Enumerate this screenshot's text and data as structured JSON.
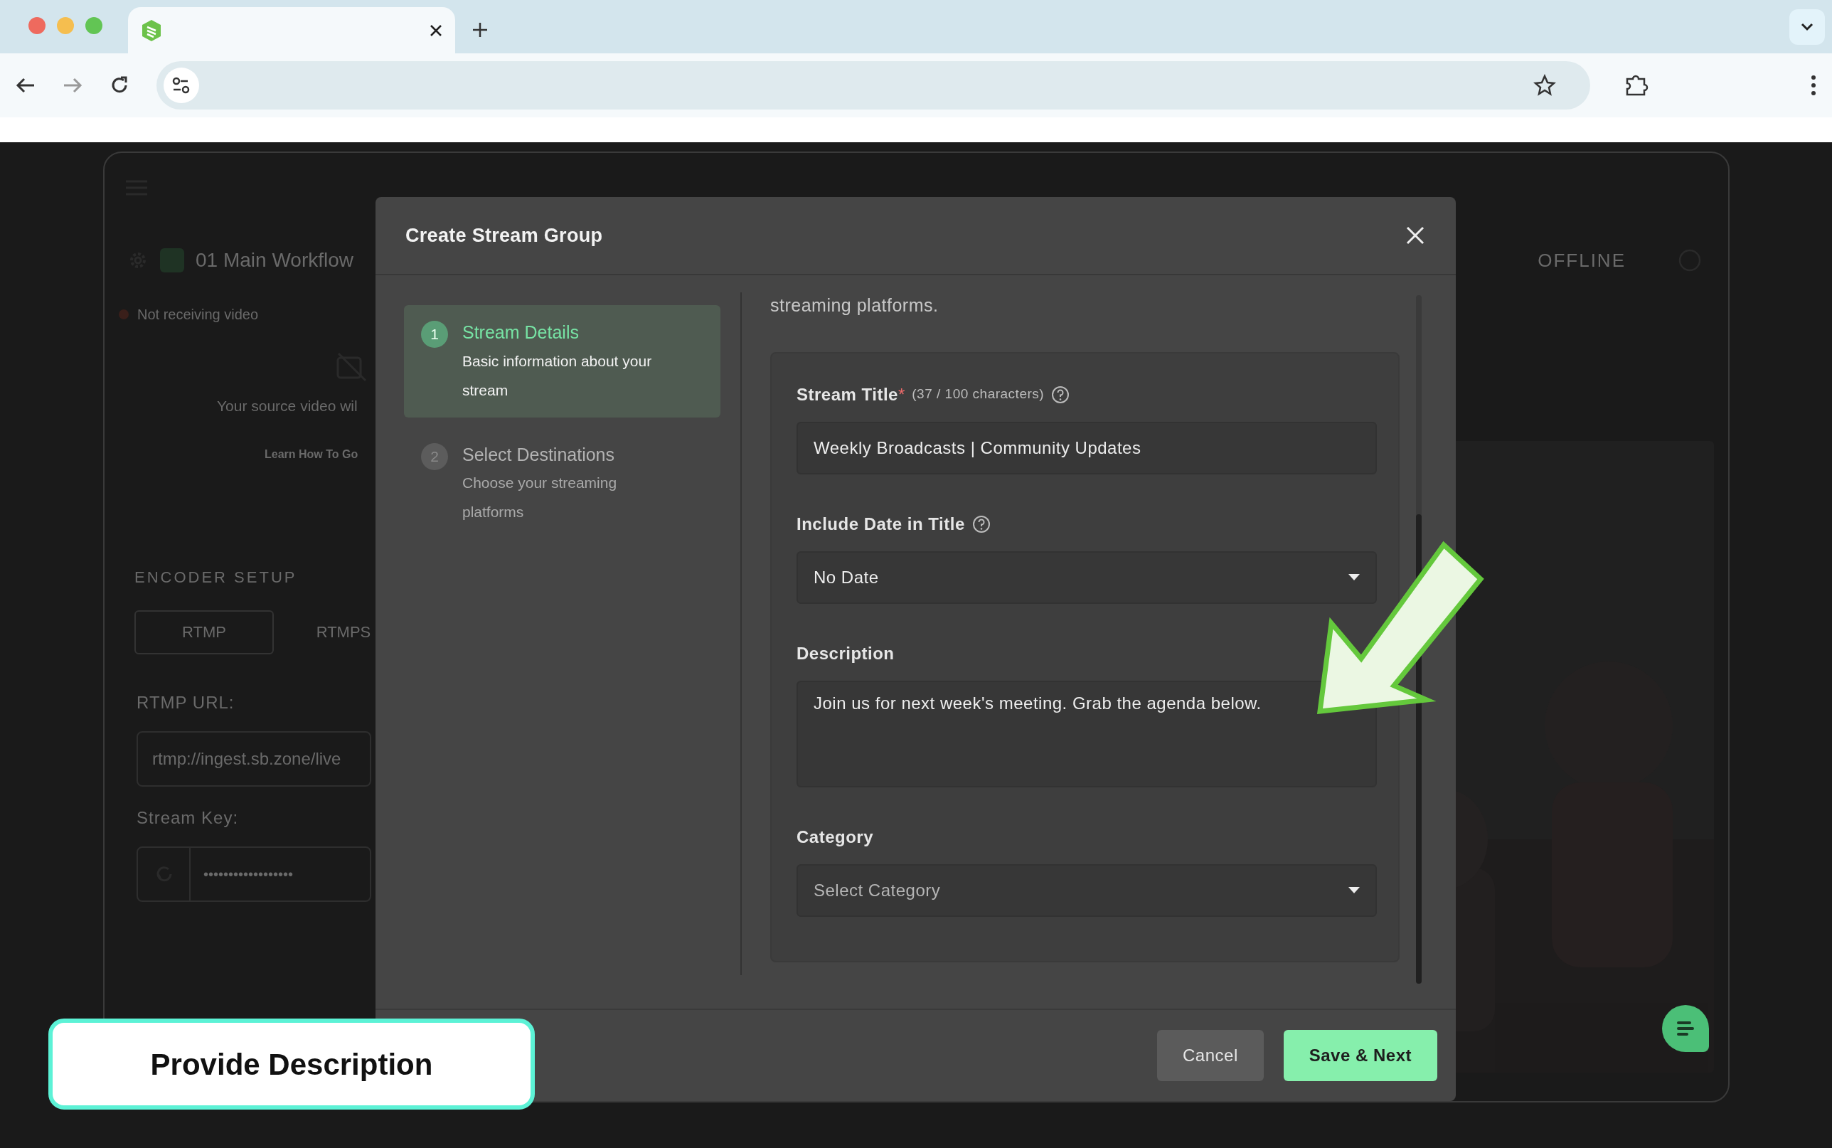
{
  "background_app": {
    "workflow_name": "01 Main Workflow",
    "connection_status": "OFFLINE",
    "status": "Not receiving video",
    "preview_message": "Your source video wil",
    "learn_link": "Learn How To Go",
    "encoder_heading": "ENCODER SETUP",
    "protocol_tabs": [
      {
        "label": "RTMP",
        "selected": true
      },
      {
        "label": "RTMPS",
        "selected": false
      }
    ],
    "rtmp_url_label": "RTMP URL:",
    "rtmp_url": "rtmp://ingest.sb.zone/live",
    "stream_key_label": "Stream Key:",
    "stream_key": "••••••••••••••••••"
  },
  "modal": {
    "title": "Create Stream Group",
    "steps": [
      {
        "number": "1",
        "title": "Stream Details",
        "subtitle": "Basic information about your stream",
        "selected": true
      },
      {
        "number": "2",
        "title": "Select Destinations",
        "subtitle": "Choose your streaming platforms",
        "selected": false
      }
    ],
    "intro_tail": "streaming platforms.",
    "fields": [
      {
        "kind": "text",
        "label": "Stream Title",
        "required_mark": "*",
        "counter": "(37 / 100 characters)",
        "help": true,
        "value": "Weekly Broadcasts | Community Updates"
      },
      {
        "kind": "select",
        "label": "Include Date in Title",
        "help": true,
        "value": "No Date"
      },
      {
        "kind": "textarea",
        "label": "Description",
        "help": false,
        "value": "Join us for next week's meeting. Grab the agenda below."
      },
      {
        "kind": "select",
        "label": "Category",
        "help": false,
        "placeholder": "Select Category"
      }
    ],
    "buttons": [
      {
        "label": "Cancel",
        "kind": "secondary"
      },
      {
        "label": "Save & Next",
        "kind": "primary"
      }
    ]
  },
  "callout": {
    "text": "Provide Description"
  }
}
